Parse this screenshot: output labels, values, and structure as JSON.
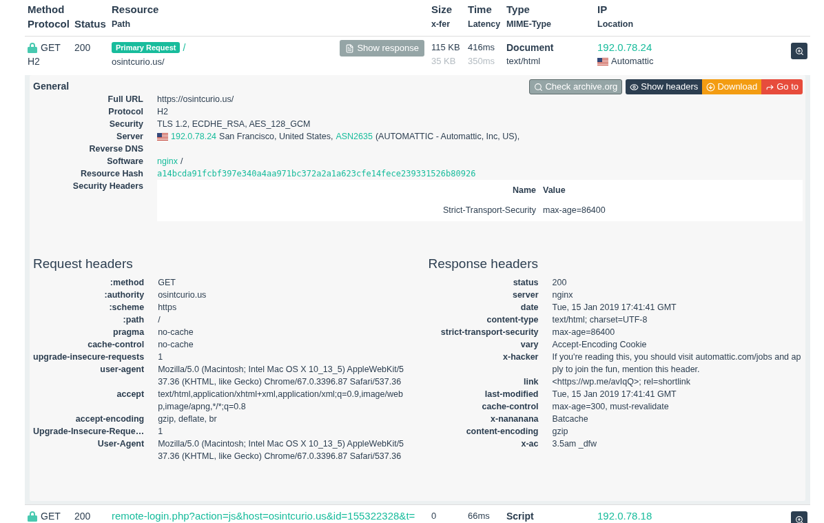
{
  "columns": [
    {
      "title": "Method",
      "subtitle": "Protocol",
      "subtitle_large": true
    },
    {
      "subtitle": "Status",
      "subtitle_large": true
    },
    {
      "title": "Resource",
      "subtitle": "Path",
      "subtitle_large": false
    },
    {
      "title": "Size",
      "subtitle": "x-fer",
      "subtitle_large": false
    },
    {
      "title": "Time",
      "subtitle": "Latency",
      "subtitle_large": false
    },
    {
      "title": "Type",
      "subtitle": "MIME-Type",
      "subtitle_large": false
    },
    {
      "title": "IP",
      "subtitle": "Location",
      "subtitle_large": false
    }
  ],
  "requests": [
    {
      "secure": true,
      "method": "GET",
      "protocol": "H2",
      "status": "200",
      "badge": "Primary Request",
      "path_link": "/",
      "path": "osintcurio.us/",
      "action": "Show response",
      "size": "115 KB",
      "size_xfer": "35 KB",
      "time": "416ms",
      "latency": "350ms",
      "type": "Document",
      "mime": "text/html",
      "ip": "192.0.78.24",
      "flag": true,
      "location": "Automattic",
      "expanded": true
    },
    {
      "secure": true,
      "method": "GET",
      "status": "200",
      "path_link": "remote-login.php?action=js&host=osintcurio.us&id=155322328&t=",
      "size": "0",
      "time": "66ms",
      "type": "Script",
      "ip": "192.0.78.18",
      "flag": false,
      "expanded": false
    }
  ],
  "detail": {
    "general": {
      "title": "General",
      "buttons": [
        {
          "label": "Check archive.org",
          "kind": "secondary"
        },
        {
          "label": "Show headers",
          "kind": "dark"
        },
        {
          "label": "Download",
          "kind": "warning"
        },
        {
          "label": "Go to",
          "kind": "danger"
        }
      ],
      "fields": [
        {
          "label": "Full URL",
          "kind": "text",
          "segments": [
            {
              "text": "https://osintcurio.us/",
              "link": false
            }
          ]
        },
        {
          "label": "Protocol",
          "kind": "text",
          "segments": [
            {
              "text": "H2",
              "link": false
            }
          ]
        },
        {
          "label": "Security",
          "kind": "text",
          "segments": [
            {
              "text": "TLS 1.2, ECDHE_RSA, AES_128_GCM",
              "link": false
            }
          ]
        },
        {
          "label": "Server",
          "kind": "text",
          "flag": true,
          "segments": [
            {
              "text": "192.0.78.24",
              "link": true
            },
            {
              "text": "San Francisco, United States,",
              "link": false
            },
            {
              "text": "ASN2635",
              "link": true
            },
            {
              "text": "(AUTOMATTIC - Automattic, Inc, US),",
              "link": false
            }
          ]
        },
        {
          "label": "Reverse DNS",
          "kind": "text"
        },
        {
          "label": "Software",
          "kind": "text",
          "segments": [
            {
              "text": "nginx",
              "link": true
            },
            {
              "text": "/",
              "link": false
            }
          ]
        },
        {
          "label": "Resource Hash",
          "kind": "hash",
          "value": "a14bcda91fcbf397e340a4aa971bc372a2a1a623cfe14fece239331526b80926"
        },
        {
          "label": "Security Headers",
          "kind": "table",
          "columns": [
            "Name",
            "Value"
          ],
          "rows": [
            [
              "Strict-Transport-Security",
              "max-age=86400"
            ]
          ]
        }
      ]
    },
    "request_headers": {
      "title": "Request headers",
      "rows": [
        {
          "name": ":method",
          "value": "GET"
        },
        {
          "name": ":authority",
          "value": "osintcurio.us"
        },
        {
          "name": ":scheme",
          "value": "https"
        },
        {
          "name": ":path",
          "value": "/"
        },
        {
          "name": "pragma",
          "value": "no-cache"
        },
        {
          "name": "cache-control",
          "value": "no-cache"
        },
        {
          "name": "upgrade-insecure-requests",
          "value": "1"
        },
        {
          "name": "user-agent",
          "value": "Mozilla/5.0 (Macintosh; Intel Mac OS X 10_13_5) AppleWebKit/537.36 (KHTML, like Gecko) Chrome/67.0.3396.87 Safari/537.36"
        },
        {
          "name": "accept",
          "value": "text/html,application/xhtml+xml,application/xml;q=0.9,image/webp,image/apng,*/*;q=0.8"
        },
        {
          "name": "accept-encoding",
          "value": "gzip, deflate, br"
        },
        {
          "name": "Upgrade-Insecure-Reque…",
          "value": "1"
        },
        {
          "name": "User-Agent",
          "value": "Mozilla/5.0 (Macintosh; Intel Mac OS X 10_13_5) AppleWebKit/537.36 (KHTML, like Gecko) Chrome/67.0.3396.87 Safari/537.36"
        }
      ]
    },
    "response_headers": {
      "title": "Response headers",
      "rows": [
        {
          "name": "status",
          "value": "200"
        },
        {
          "name": "server",
          "value": "nginx"
        },
        {
          "name": "date",
          "value": "Tue, 15 Jan 2019 17:41:41 GMT"
        },
        {
          "name": "content-type",
          "value": "text/html; charset=UTF-8"
        },
        {
          "name": "strict-transport-security",
          "value": "max-age=86400"
        },
        {
          "name": "vary",
          "value": "Accept-Encoding Cookie"
        },
        {
          "name": "x-hacker",
          "value": "If you're reading this, you should visit automattic.com/jobs and apply to join the fun, mention this header."
        },
        {
          "name": "link",
          "value": "<https://wp.me/avIqQ>; rel=shortlink"
        },
        {
          "name": "last-modified",
          "value": "Tue, 15 Jan 2019 17:41:41 GMT"
        },
        {
          "name": "cache-control",
          "value": "max-age=300, must-revalidate"
        },
        {
          "name": "x-nananana",
          "value": "Batcache"
        },
        {
          "name": "content-encoding",
          "value": "gzip"
        },
        {
          "name": "x-ac",
          "value": "3.5am _dfw"
        }
      ]
    }
  }
}
